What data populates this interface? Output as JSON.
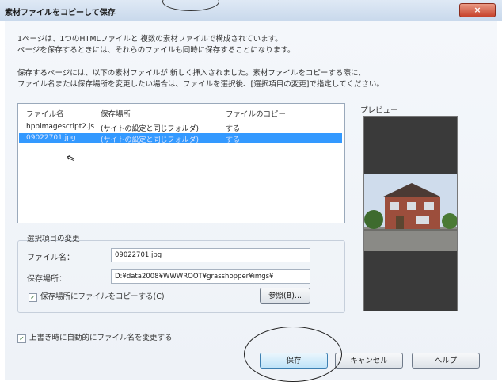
{
  "window": {
    "title": "素材ファイルをコピーして保存",
    "close_label": "×"
  },
  "description": {
    "line1": "1ページは、1つのHTMLファイルと 複数の素材ファイルで構成されています。",
    "line2": "ページを保存するときには、それらのファイルも同時に保存することになります。",
    "line3": "保存するページには、以下の素材ファイルが 新しく挿入されました。素材ファイルをコピーする際に、",
    "line4": "ファイル名または保存場所を変更したい場合は、ファイルを選択後、[選択項目の変更]で指定してください。"
  },
  "file_list": {
    "columns": [
      "ファイル名",
      "保存場所",
      "ファイルのコピー"
    ],
    "rows": [
      {
        "name": "hpbimagescript2.js",
        "location": "(サイトの設定と同じフォルダ)",
        "copy": "する",
        "selected": false
      },
      {
        "name": "09022701.jpg",
        "location": "(サイトの設定と同じフォルダ)",
        "copy": "する",
        "selected": true
      }
    ]
  },
  "preview": {
    "label": "プレビュー"
  },
  "change_group": {
    "title": "選択項目の変更",
    "filename_label": "ファイル名：",
    "filename_value": "09022701.jpg",
    "location_label": "保存場所：",
    "location_value": "D:¥data2008¥WWWROOT¥grasshopper¥imgs¥",
    "copy_checkbox_label": "保存場所にファイルをコピーする(C)",
    "copy_checked": true,
    "browse_label": "参照(B)..."
  },
  "auto_rename": {
    "label": "上書き時に自動的にファイル名を変更する",
    "checked": true
  },
  "buttons": {
    "save": "保存",
    "cancel": "キャンセル",
    "help": "ヘルプ"
  },
  "colors": {
    "selection": "#3399ff",
    "title_bar": "#dfe9f5",
    "close_button": "#c6412a"
  }
}
